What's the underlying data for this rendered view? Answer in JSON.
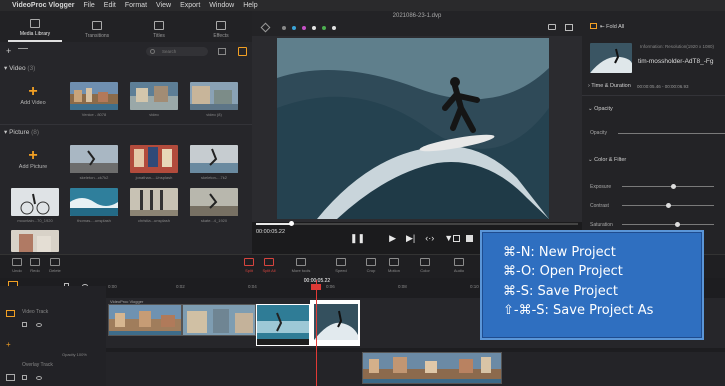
{
  "menubar": {
    "apple": "",
    "app_name": "VideoProc Vlogger",
    "items": [
      "File",
      "Edit",
      "Format",
      "View",
      "Export",
      "Window",
      "Help"
    ]
  },
  "left_panel": {
    "tabs": [
      {
        "label": "Media Library",
        "active": true
      },
      {
        "label": "Transitions",
        "active": false
      },
      {
        "label": "Titles",
        "active": false
      },
      {
        "label": "Effects",
        "active": false
      }
    ],
    "search_placeholder": "Search",
    "video_section": {
      "title": "Video",
      "count": "(3)",
      "add_label": "Add Video",
      "items": [
        {
          "label": "Venice - 8078"
        },
        {
          "label": "video"
        },
        {
          "label": "video (8)"
        }
      ]
    },
    "picture_section": {
      "title": "Picture",
      "count": "(8)",
      "add_label": "Add Picture",
      "items": [
        {
          "label": "skeleton...ck7k2"
        },
        {
          "label": "jonathan-...Unsplash"
        },
        {
          "label": "skeleton-...7k2"
        },
        {
          "label": "mountain...70_1920"
        },
        {
          "label": "thomas-...unsplash"
        },
        {
          "label": "christia...unsplash"
        },
        {
          "label": "skate...4_1920"
        },
        {
          "label": ""
        }
      ]
    }
  },
  "preview": {
    "title": "2021086-23-1.dvp",
    "timecode": "00:00:05.22",
    "progress": 0.11
  },
  "right_panel": {
    "fold_all": "Fold All",
    "info": "Information: Resolution(1920 x 1080)",
    "clip_name": "tim-mossholder-AdT8_-Fg",
    "time_duration_label": "Time & Duration",
    "time_duration_value": "00:00:05.46 - 00:00:06.93",
    "opacity_section": "Opacity",
    "opacity_label": "Opacity",
    "color_filter_section": "Color & Filter",
    "exposure_label": "Exposure",
    "contrast_label": "Contrast",
    "saturation_label": "Saturation",
    "levels": {
      "opacity": 1.0,
      "exposure": 0.55,
      "contrast": 0.5,
      "saturation": 0.6
    }
  },
  "toolbar": {
    "undo": "Undo",
    "redo": "Redo",
    "delete": "Delete",
    "split": "Split",
    "split_all": "Split All",
    "more": "More tools",
    "speed": "Speed",
    "crop": "Crop",
    "motion": "Motion",
    "color": "Color",
    "audio": "Audio",
    "zoom_out": "",
    "zoom_in": ""
  },
  "timeline": {
    "duration": "Duration 00:00:05.22",
    "playhead_time": "00:00:05.22",
    "ticks": [
      "0:00",
      "0:02",
      "0:04",
      "0:06",
      "0:08",
      "0:10",
      "0:12"
    ],
    "video_track_label": "Video Track",
    "overlay_track_label": "Overlay Track",
    "clip_label": "VideoProc Vlogger",
    "opacity_readout": "Opacity 100%"
  },
  "shortcuts": [
    "⌘-N: New Project",
    "⌘-O: Open Project",
    "⌘-S: Save Project",
    "⇧-⌘-S: Save Project As"
  ],
  "colors": {
    "accent_orange": "#f2a024",
    "playhead_red": "#e03a36",
    "overlay_blue": "#2f6fc0"
  }
}
